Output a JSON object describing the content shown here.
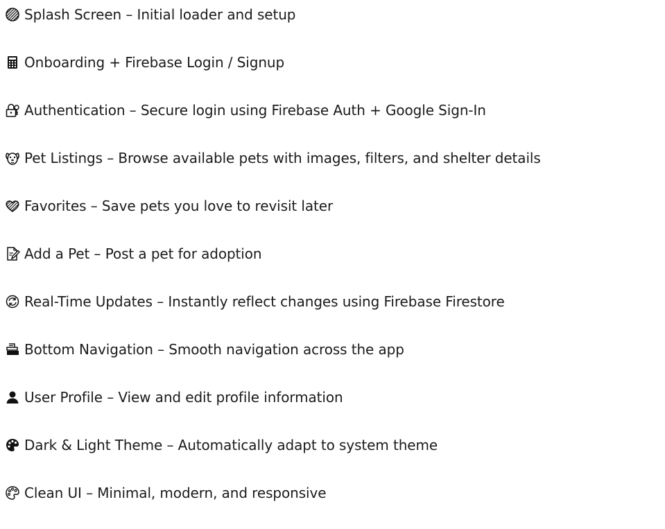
{
  "features": [
    {
      "icon": "hatched-circle-icon",
      "text": "Splash Screen – Initial loader and setup"
    },
    {
      "icon": "calculator-icon",
      "text": "Onboarding + Firebase Login / Signup"
    },
    {
      "icon": "lock-with-key-icon",
      "text": "Authentication – Secure login using Firebase Auth + Google Sign-In"
    },
    {
      "icon": "dog-face-icon",
      "text": "Pet Listings – Browse available pets with images, filters, and shelter details"
    },
    {
      "icon": "heart-icon",
      "text": "Favorites – Save pets you love to revisit later"
    },
    {
      "icon": "memo-pencil-icon",
      "text": "Add a Pet – Post a pet for adoption"
    },
    {
      "icon": "refresh-arrows-icon",
      "text": "Real-Time Updates – Instantly reflect changes using Firebase Firestore"
    },
    {
      "icon": "navigation-stack-icon",
      "text": "Bottom Navigation – Smooth navigation across the app"
    },
    {
      "icon": "user-silhouette-icon",
      "text": "User Profile – View and edit profile information"
    },
    {
      "icon": "theme-palette-dark-icon",
      "text": "Dark & Light Theme – Automatically adapt to system theme"
    },
    {
      "icon": "palette-icon",
      "text": "Clean UI – Minimal, modern, and responsive"
    }
  ]
}
